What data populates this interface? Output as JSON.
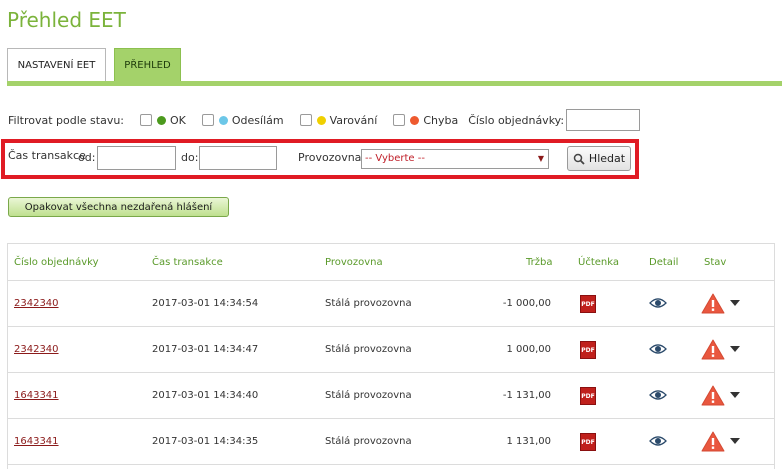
{
  "page_title": "Přehled EET",
  "tabs": [
    {
      "label": "NASTAVENÍ EET"
    },
    {
      "label": "PŘEHLED"
    }
  ],
  "filter": {
    "label": "Filtrovat podle stavu:",
    "states": [
      {
        "label": "OK",
        "color": "#4c9a1e"
      },
      {
        "label": "Odesílám",
        "color": "#6cc7e8"
      },
      {
        "label": "Varování",
        "color": "#f0d000"
      },
      {
        "label": "Chyba",
        "color": "#ee5a2f"
      }
    ],
    "order_label": "Číslo objednávky:",
    "time_label": "Čas transakce",
    "from_label": "od:",
    "to_label": "do:",
    "branch_label": "Provozovna:",
    "branch_selected": "-- Vyberte --",
    "search_button": "Hledat"
  },
  "retry_button": "Opakovat všechna nezdařená hlášení",
  "table": {
    "headers": [
      "Číslo objednávky",
      "Čas transakce",
      "Provozovna",
      "Tržba",
      "Účtenka",
      "Detail",
      "Stav"
    ],
    "rows": [
      {
        "order": "2342340",
        "time": "2017-03-01 14:34:54",
        "branch": "Stálá provozovna",
        "amount": "-1 000,00"
      },
      {
        "order": "2342340",
        "time": "2017-03-01 14:34:47",
        "branch": "Stálá provozovna",
        "amount": "1 000,00"
      },
      {
        "order": "1643341",
        "time": "2017-03-01 14:34:40",
        "branch": "Stálá provozovna",
        "amount": "-1 131,00"
      },
      {
        "order": "1643341",
        "time": "2017-03-01 14:34:35",
        "branch": "Stálá provozovna",
        "amount": "1 131,00"
      }
    ],
    "pdf_label": "PDF"
  }
}
